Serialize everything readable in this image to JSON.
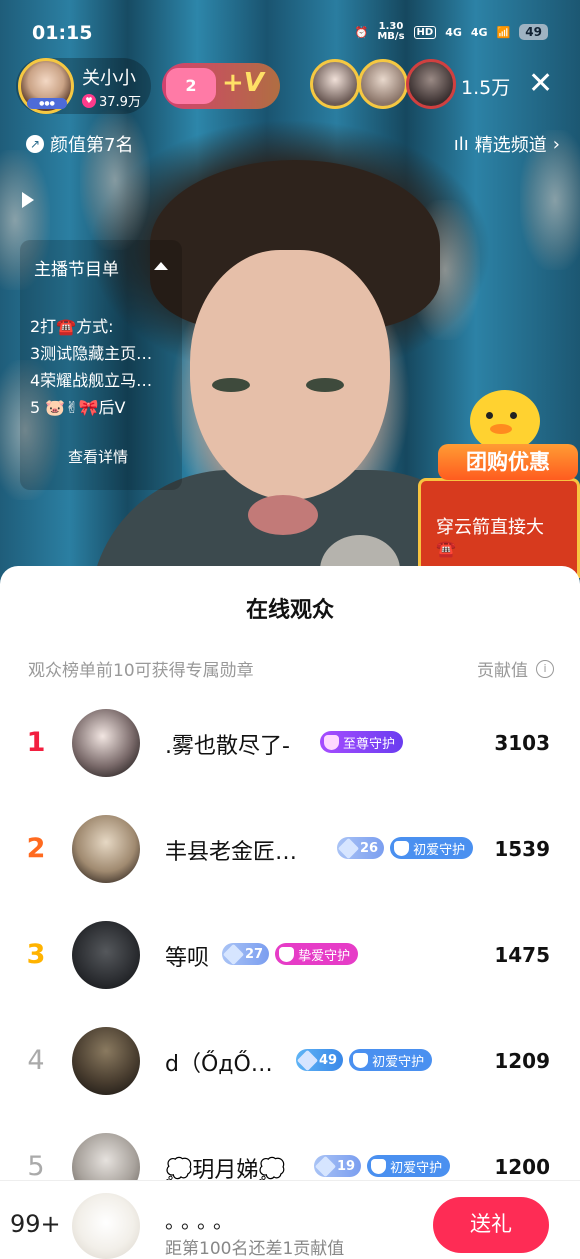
{
  "status_bar": {
    "time": "01:15",
    "net_speed_value": "1.30",
    "net_speed_unit": "MB/s",
    "hd_label": "HD",
    "sim1": "4G",
    "sim2": "4G",
    "battery": "49"
  },
  "host": {
    "name": "关小小",
    "likes": "37.9万",
    "follow_count": "2",
    "follow_v": "+V",
    "viewer_count": "1.5万",
    "close_icon": "close-icon"
  },
  "rank": {
    "label": "颜值第7名",
    "channel": "精选频道"
  },
  "program": {
    "title": "主播节目单",
    "items": [
      "2打☎️方式:",
      "3测试隐藏主页…",
      "4荣耀战舰立马…",
      "5 🐷✌🎀后V"
    ],
    "more": "查看详情"
  },
  "promo": {
    "banner": "团购优惠",
    "text": "穿云箭直接大",
    "phone": "☎️"
  },
  "audience": {
    "title": "在线观众",
    "subtitle": "观众榜单前10可获得专属勋章",
    "metric_label": "贡献值",
    "info_icon": "i",
    "rows": [
      {
        "rank": "1",
        "name": ".雾也散尽了-",
        "level": "",
        "guard": "至尊守护",
        "score": "3103"
      },
      {
        "rank": "2",
        "name": "丰县老金匠…",
        "level": "26",
        "guard": "初爱守护",
        "score": "1539"
      },
      {
        "rank": "3",
        "name": "等呗",
        "level": "27",
        "guard": "挚爱守护",
        "score": "1475"
      },
      {
        "rank": "4",
        "name": "d（ŐдŐ…",
        "level": "49",
        "guard": "初爱守护",
        "score": "1209"
      },
      {
        "rank": "5",
        "name": "💭玥月娣💭",
        "level": "19",
        "guard": "初爱守护",
        "score": "1200"
      }
    ]
  },
  "me": {
    "rank": "99+",
    "name": "。。。。",
    "gap_text": "距第100名还差1贡献值",
    "gift_button": "送礼"
  },
  "colors": {
    "rank1": "#f21f3f",
    "rank2": "#ff6a1f",
    "rank3": "#ffb300",
    "rank_other": "#aaaaaa",
    "guard_supreme": "#7c4dff",
    "guard_first": "#4a90f0",
    "guard_love": "#e63cc7",
    "gift_button": "#fe2c55"
  }
}
